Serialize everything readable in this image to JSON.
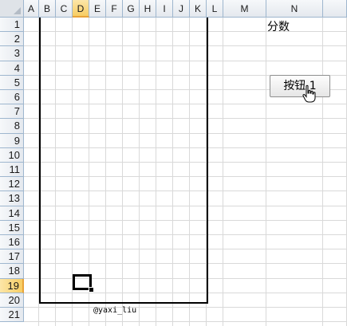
{
  "columns": [
    {
      "label": "A",
      "selected": false
    },
    {
      "label": "B",
      "selected": false
    },
    {
      "label": "C",
      "selected": false
    },
    {
      "label": "D",
      "selected": true
    },
    {
      "label": "E",
      "selected": false
    },
    {
      "label": "F",
      "selected": false
    },
    {
      "label": "G",
      "selected": false
    },
    {
      "label": "H",
      "selected": false
    },
    {
      "label": "I",
      "selected": false
    },
    {
      "label": "J",
      "selected": false
    },
    {
      "label": "K",
      "selected": false
    },
    {
      "label": "L",
      "selected": false
    },
    {
      "label": "M",
      "selected": false
    },
    {
      "label": "N",
      "selected": false
    }
  ],
  "rows": [
    "1",
    "2",
    "3",
    "4",
    "5",
    "6",
    "7",
    "8",
    "9",
    "10",
    "11",
    "12",
    "13",
    "14",
    "15",
    "16",
    "17",
    "18",
    "19",
    "20",
    "21"
  ],
  "selected_row": "19",
  "cells": {
    "score_label": "分数",
    "credit": "@yaxi_liu"
  },
  "button": {
    "label": "按钮 1"
  },
  "colors": {
    "header_bg": "#e4e8ee",
    "header_selected": "#f7cd63",
    "gridline": "#d9d9d9",
    "border": "#000000"
  }
}
